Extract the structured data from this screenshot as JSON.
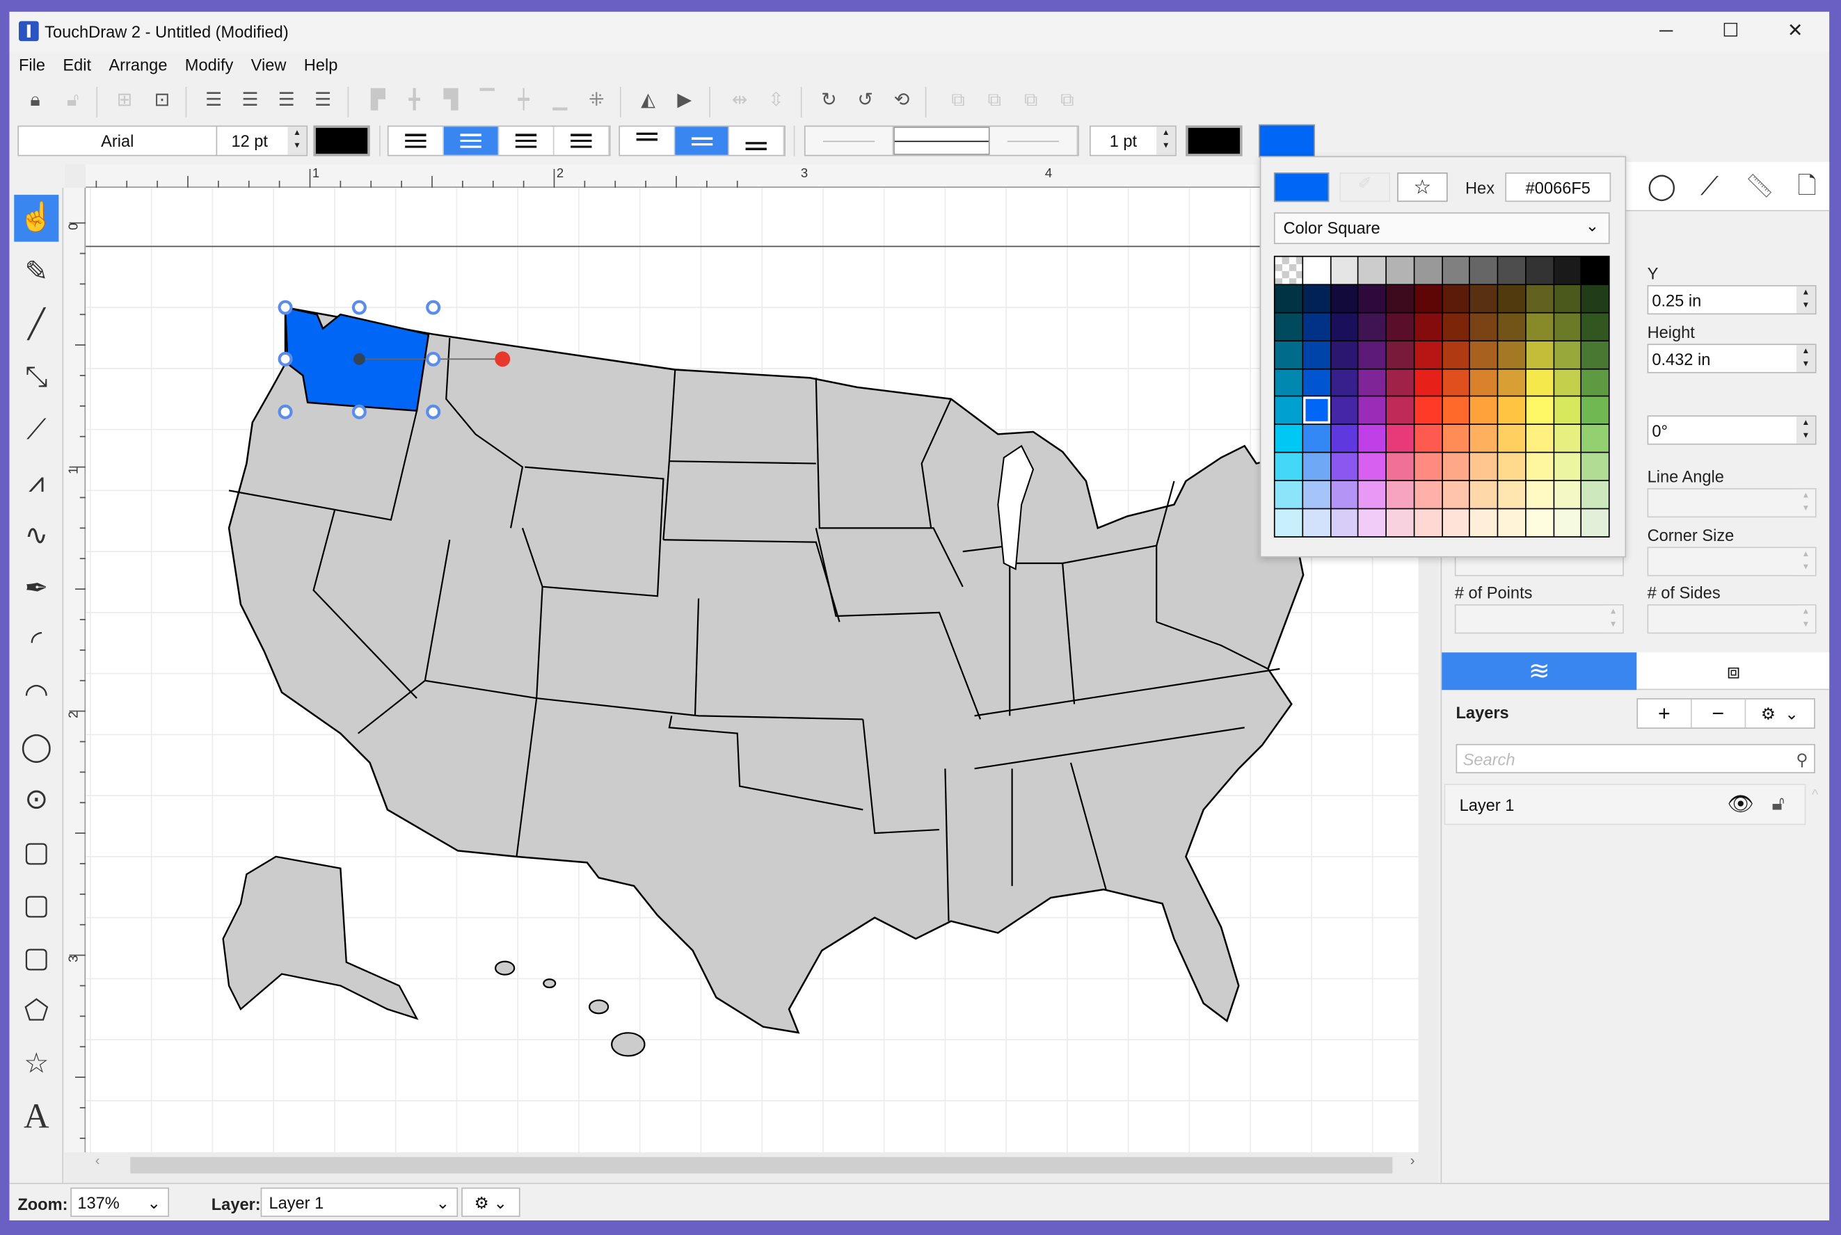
{
  "window": {
    "title": "TouchDraw 2 - Untitled (Modified)",
    "minimize": "─",
    "maximize": "☐",
    "close": "✕"
  },
  "menu": [
    "File",
    "Edit",
    "Arrange",
    "Modify",
    "View",
    "Help"
  ],
  "format_bar": {
    "font": "Arial",
    "font_size": "12 pt",
    "line_width": "1 pt",
    "text_color": "#000000",
    "stroke_color": "#000000",
    "fill_color": "#0066F5"
  },
  "color_popup": {
    "hex_label": "Hex",
    "hex_value": "#0066F5",
    "mode": "Color Square",
    "mode_chevron": "⌄",
    "current_color": "#0066F5",
    "selected_cell": [
      5,
      1
    ],
    "palette": [
      [
        "transparent",
        "#ffffff",
        "#e5e5e5",
        "#cccccc",
        "#b3b3b3",
        "#999999",
        "#808080",
        "#666666",
        "#4d4d4d",
        "#333333",
        "#1a1a1a",
        "#000000"
      ],
      [
        "#003344",
        "#002255",
        "#110a3a",
        "#2d0a3b",
        "#3d0a1d",
        "#5e0505",
        "#5c1a08",
        "#5a3110",
        "#513b0e",
        "#636120",
        "#4b5a1c",
        "#213d17"
      ],
      [
        "#004a5e",
        "#003388",
        "#1a0f5a",
        "#401452",
        "#5a0e29",
        "#850c0c",
        "#7d2509",
        "#7a4315",
        "#725419",
        "#888a2a",
        "#6a7a26",
        "#32561f"
      ],
      [
        "#006b8a",
        "#0044aa",
        "#2b1670",
        "#5e1a78",
        "#7a1a3a",
        "#b81515",
        "#b03a12",
        "#a8611e",
        "#a57824",
        "#c4bd3a",
        "#98a83a",
        "#487832"
      ],
      [
        "#0088b0",
        "#0055d0",
        "#371f8c",
        "#7f2598",
        "#a02248",
        "#e8201a",
        "#e04f1e",
        "#d8822c",
        "#d8a034",
        "#f5e84c",
        "#c4d04c",
        "#5e9a42"
      ],
      [
        "#00a0d0",
        "#0066f5",
        "#4526a6",
        "#9a2cb8",
        "#c02a58",
        "#ff3a26",
        "#ff6a2a",
        "#ffa23a",
        "#ffc542",
        "#fff866",
        "#d8e85c",
        "#70b852"
      ],
      [
        "#00c8f5",
        "#3388f5",
        "#6038e0",
        "#c040e8",
        "#e83a78",
        "#ff5a50",
        "#ff8c56",
        "#ffb05e",
        "#ffd060",
        "#fff080",
        "#e6f080",
        "#92d070"
      ],
      [
        "#44d8f8",
        "#70a8f8",
        "#8a58f0",
        "#d860f0",
        "#f07098",
        "#ff8a80",
        "#ffa888",
        "#ffc690",
        "#ffda8c",
        "#fff7a0",
        "#ecf5a0",
        "#b0dc94"
      ],
      [
        "#8ce4fa",
        "#a4c4fa",
        "#b494f4",
        "#e898f5",
        "#f6a4c0",
        "#ffb0a8",
        "#ffc4ac",
        "#ffd8aa",
        "#ffe6b0",
        "#fffac4",
        "#f3f8c4",
        "#cce8bc"
      ],
      [
        "#c8f0fc",
        "#d2e2fc",
        "#d8ccf8",
        "#f2ccf8",
        "#f9d2e0",
        "#ffd8d4",
        "#ffe2d8",
        "#ffeed8",
        "#fff4d8",
        "#fffde0",
        "#f6fae0",
        "#e2f0da"
      ]
    ]
  },
  "properties": {
    "y_label": "Y",
    "y_value": "0.25 in",
    "height_label": "Height",
    "height_value": "0.432 in",
    "rotation_value": "0°",
    "line_angle_label": "Line Angle",
    "corner_size_label": "Corner Size",
    "points_label": "# of Points",
    "sides_label": "# of Sides"
  },
  "ruler": {
    "h": [
      "1",
      "2",
      "3",
      "4"
    ],
    "v": [
      "0",
      "1",
      "2",
      "3"
    ]
  },
  "layers": {
    "title": "Layers",
    "add": "+",
    "remove": "−",
    "search_placeholder": "Search",
    "items": [
      {
        "name": "Layer 1",
        "visible": true,
        "locked": false
      }
    ]
  },
  "status": {
    "zoom_label": "Zoom:",
    "zoom_value": "137%",
    "layer_label": "Layer:",
    "layer_value": "Layer 1"
  },
  "colors": {
    "accent": "#3a86f0",
    "selection": "#0066F5",
    "state_fill": "#cccccc",
    "frame": "#6a60c4"
  }
}
